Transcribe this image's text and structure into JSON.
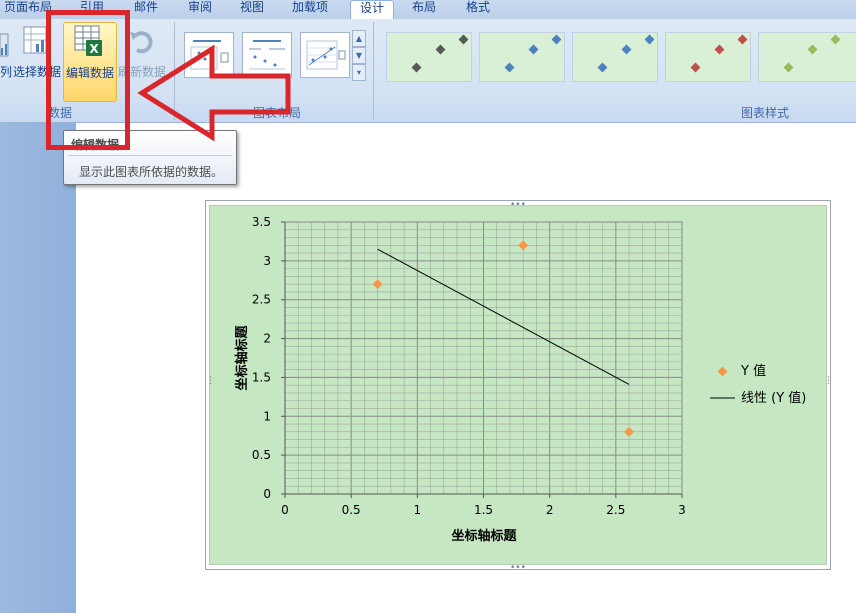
{
  "tabs": [
    {
      "label": "页面布局",
      "active": false
    },
    {
      "label": "引用",
      "active": false
    },
    {
      "label": "邮件",
      "active": false
    },
    {
      "label": "审阅",
      "active": false
    },
    {
      "label": "视图",
      "active": false
    },
    {
      "label": "加载项",
      "active": false
    },
    {
      "label": "设计",
      "active": true
    },
    {
      "label": "布局",
      "active": false
    },
    {
      "label": "格式",
      "active": false
    }
  ],
  "ribbon": {
    "data_group": {
      "label": "数据",
      "switch_row_col": "列",
      "select_data": "选择数据",
      "edit_data": "编辑数据",
      "refresh_data": "刷新数据"
    },
    "layout_group": {
      "label": "图表布局"
    },
    "styles_group": {
      "label": "图表样式"
    }
  },
  "tooltip": {
    "title": "编辑数据",
    "description": "显示此图表所依据的数据。"
  },
  "colors": {
    "annotation_red": "#d9262b",
    "chart_area": "#c5e8c3",
    "marker_orange": "#f79646",
    "trend_line": "#000000"
  },
  "chart_data": {
    "type": "scatter",
    "title": "",
    "xlabel": "坐标轴标题",
    "ylabel": "坐标轴标题",
    "xlim": [
      0,
      3
    ],
    "ylim": [
      0,
      3.5
    ],
    "xticks": [
      "0",
      "0.5",
      "1",
      "1.5",
      "2",
      "2.5",
      "3"
    ],
    "yticks": [
      "0",
      "0.5",
      "1",
      "1.5",
      "2",
      "2.5",
      "3",
      "3.5"
    ],
    "grid": true,
    "legend": "right",
    "series": [
      {
        "name": "Y 值",
        "kind": "scatter",
        "marker": "diamond",
        "x": [
          0.7,
          1.8,
          2.6
        ],
        "y": [
          2.7,
          3.2,
          0.8
        ]
      },
      {
        "name": "线性 (Y 值)",
        "kind": "line",
        "x": [
          0.7,
          2.6
        ],
        "y": [
          3.15,
          1.41
        ]
      }
    ]
  }
}
